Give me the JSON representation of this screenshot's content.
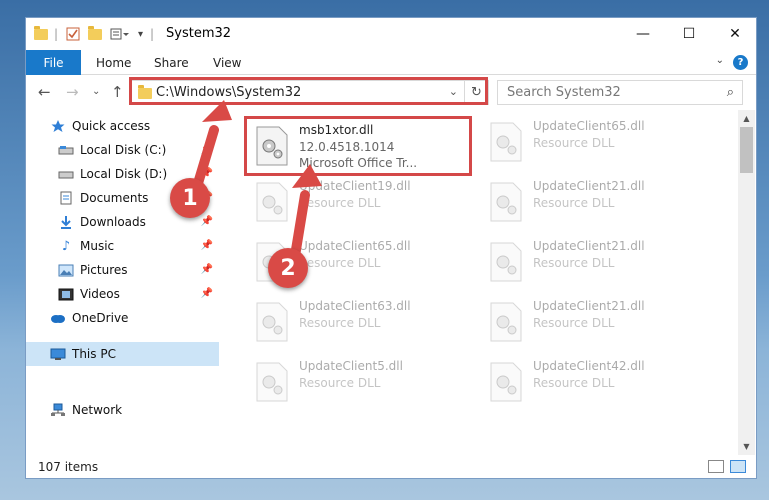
{
  "window": {
    "title": "System32",
    "controls": {
      "minimize": "—",
      "maximize": "☐",
      "close": "✕"
    }
  },
  "ribbon": {
    "tabs": [
      "File",
      "Home",
      "Share",
      "View"
    ],
    "help": "?"
  },
  "address": {
    "path": "C:\\Windows\\System32",
    "search_placeholder": "Search System32"
  },
  "nav": {
    "items": [
      {
        "label": "Quick access",
        "icon": "star-icon"
      },
      {
        "label": "Local Disk (C:)",
        "icon": "drive-icon",
        "pinned": true
      },
      {
        "label": "Local Disk (D:)",
        "icon": "drive-icon",
        "pinned": true
      },
      {
        "label": "Documents",
        "icon": "documents-icon",
        "pinned": true
      },
      {
        "label": "Downloads",
        "icon": "download-icon",
        "pinned": true
      },
      {
        "label": "Music",
        "icon": "music-icon",
        "pinned": true
      },
      {
        "label": "Pictures",
        "icon": "pictures-icon",
        "pinned": true
      },
      {
        "label": "Videos",
        "icon": "videos-icon",
        "pinned": true
      },
      {
        "label": "OneDrive",
        "icon": "cloud-icon"
      },
      {
        "label": "This PC",
        "icon": "computer-icon",
        "selected": true
      },
      {
        "label": "Network",
        "icon": "network-icon"
      }
    ]
  },
  "files": {
    "highlighted": {
      "name": "msb1xtor.dll",
      "version": "12.0.4518.1014",
      "description": "Microsoft Office Tr..."
    },
    "faded": [
      {
        "name": "UpdateClient65.dll",
        "description": "Resource DLL"
      },
      {
        "name": "UpdateClient19.dll",
        "description": "Resource DLL"
      },
      {
        "name": "UpdateClient21.dll",
        "description": "Resource DLL"
      },
      {
        "name": "UpdateClient65.dll",
        "description": "Resource DLL"
      },
      {
        "name": "UpdateClient21.dll",
        "description": "Resource DLL"
      },
      {
        "name": "UpdateClient63.dll",
        "description": "Resource DLL"
      },
      {
        "name": "UpdateClient21.dll",
        "description": "Resource DLL"
      },
      {
        "name": "UpdateClient5.dll",
        "description": "Resource DLL"
      },
      {
        "name": "UpdateClient42.dll",
        "description": "Resource DLL"
      }
    ]
  },
  "status": {
    "item_count": "107 items"
  },
  "annotations": {
    "step1": "1",
    "step2": "2",
    "color": "#d94a46"
  }
}
